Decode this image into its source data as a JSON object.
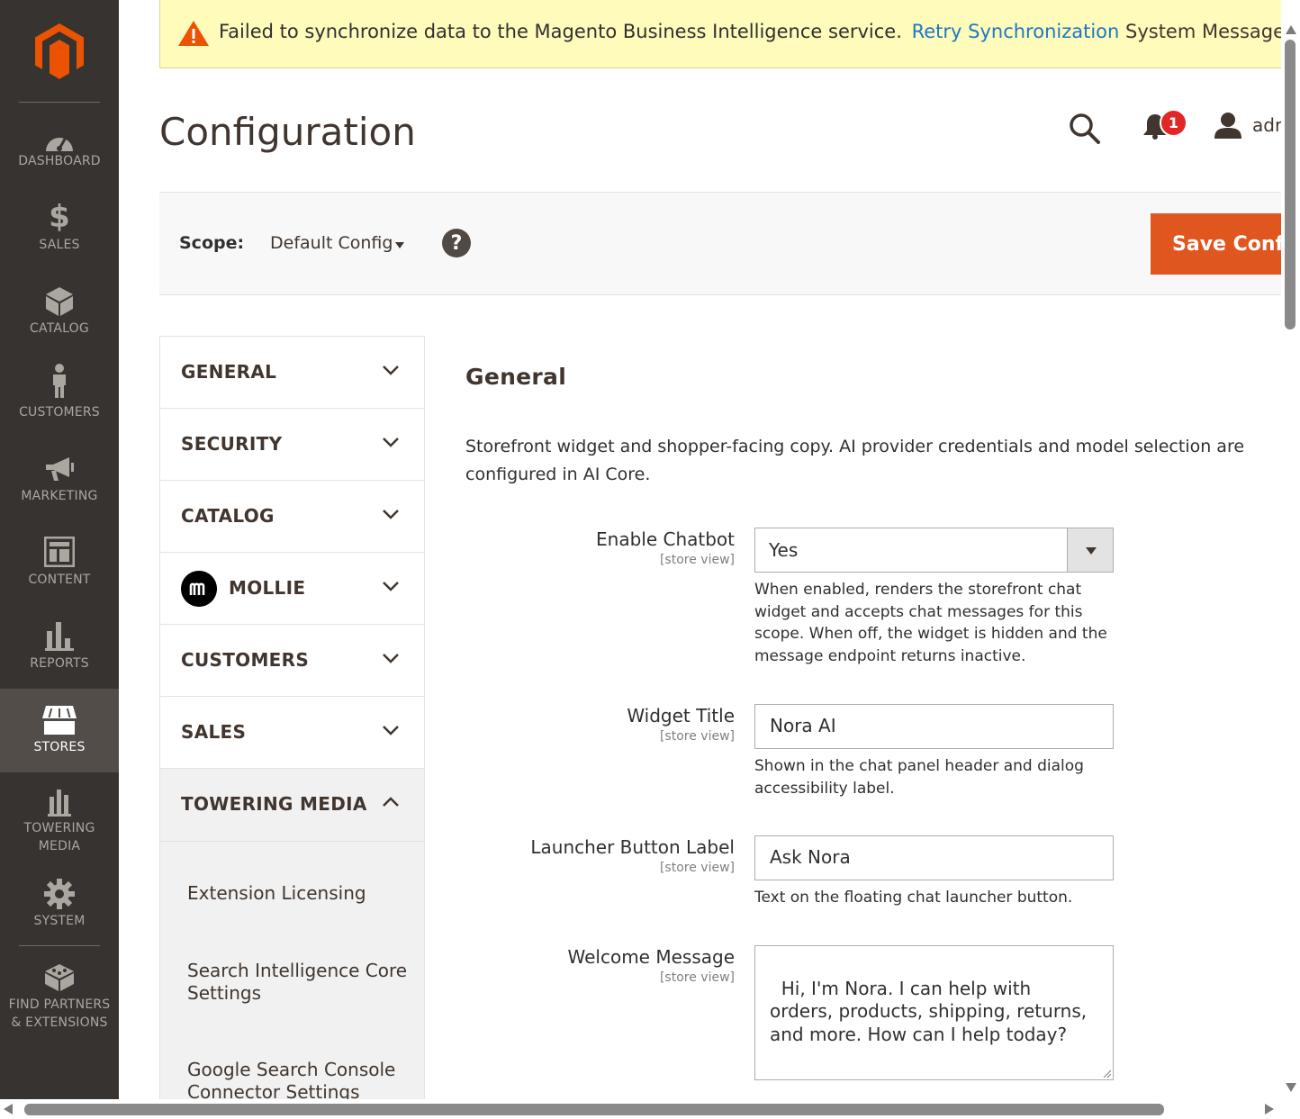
{
  "nav": {
    "items": [
      {
        "label": "DASHBOARD",
        "icon": "dashboard-icon"
      },
      {
        "label": "$",
        "icon": "dollar-icon"
      },
      {
        "label": "SALES"
      },
      {
        "label": "CATALOG",
        "icon": "box-icon"
      },
      {
        "label": "CUSTOMERS",
        "icon": "person-icon"
      },
      {
        "label": "MARKETING",
        "icon": "megaphone-icon"
      },
      {
        "label": "CONTENT",
        "icon": "layout-icon"
      },
      {
        "label": "REPORTS",
        "icon": "bar-chart-icon"
      },
      {
        "label": "STORES",
        "icon": "storefront-icon"
      },
      {
        "label": "TOWERING",
        "icon": "towers-icon"
      },
      {
        "label": "MEDIA"
      },
      {
        "label": "SYSTEM",
        "icon": "gear-icon"
      },
      {
        "label": "FIND PARTNERS",
        "icon": "blocks-icon"
      },
      {
        "label": "& EXTENSIONS"
      }
    ],
    "active": "STORES"
  },
  "system_message": {
    "text": "Failed to synchronize data to the Magento Business Intelligence service.",
    "link": "Retry Synchronization",
    "system_messages_label": "System Messages"
  },
  "header": {
    "title": "Configuration",
    "notification_count": "1",
    "user_name": "adr"
  },
  "scope": {
    "label": "Scope:",
    "value": "Default Config",
    "help": "?",
    "save_label": "Save Conf"
  },
  "tabs": {
    "sections": [
      {
        "title": "GENERAL"
      },
      {
        "title": "SECURITY"
      },
      {
        "title": "CATALOG"
      },
      {
        "title": "MOLLIE"
      },
      {
        "title": "CUSTOMERS"
      },
      {
        "title": "SALES"
      },
      {
        "title": "TOWERING MEDIA"
      }
    ],
    "towering_items": [
      "Extension Licensing",
      "Search Intelligence Core Settings",
      "Google Search Console Connector Settings"
    ]
  },
  "content": {
    "section_title": "General",
    "description": "Storefront widget and shopper-facing copy. AI provider credentials and model selection are configured in AI Core.",
    "fields": [
      {
        "label": "Enable Chatbot",
        "scope": "[store view]",
        "value": "Yes",
        "note": "When enabled, renders the storefront chat widget and accepts chat messages for this scope. When off, the widget is hidden and the message endpoint returns inactive."
      },
      {
        "label": "Widget Title",
        "scope": "[store view]",
        "value": "Nora AI",
        "note": "Shown in the chat panel header and dialog accessibility label."
      },
      {
        "label": "Launcher Button Label",
        "scope": "[store view]",
        "value": "Ask Nora",
        "note": "Text on the floating chat launcher button."
      },
      {
        "label": "Welcome Message",
        "scope": "[store view]",
        "value": "Hi, I'm Nora. I can help with orders, products, shipping, returns, and more. How can I help today?"
      }
    ]
  },
  "colors": {
    "nav_bg": "#373330",
    "nav_active": "#524d49",
    "brand_orange": "#e0561f",
    "link_blue": "#1979c3",
    "message_bg": "#fffbbb",
    "badge_red": "#e22626"
  }
}
